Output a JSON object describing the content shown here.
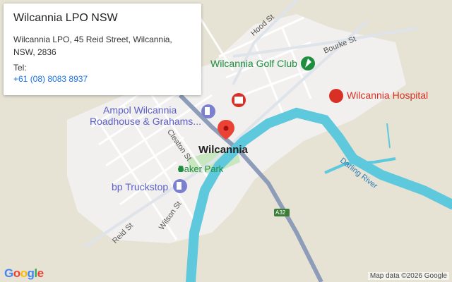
{
  "card": {
    "title": "Wilcannia LPO NSW",
    "address": "Wilcannia LPO, 45 Reid Street, Wilcannia, NSW, 2836",
    "tel_label": "Tel:",
    "phone": "+61 (08) 8083 8937"
  },
  "map": {
    "town_label": "Wilcannia",
    "pois": {
      "golf_club": "Wilcannia Golf Club",
      "hospital": "Wilcannia Hospital",
      "ampol_line1": "Ampol Wilcannia",
      "ampol_line2": "Roadhouse & Grahams...",
      "bp": "bp Truckstop",
      "park": "Baker Park"
    },
    "streets": {
      "hood": "Hood St",
      "bourke": "Bourke St",
      "cleaton": "Cleaton St",
      "wilson": "Wilson St",
      "reid": "Reid St"
    },
    "river": "Darling River",
    "highway_shield": "A32",
    "attribution": "Map data ©2026 Google",
    "logo": [
      "G",
      "o",
      "o",
      "g",
      "l",
      "e"
    ],
    "colors": {
      "water": "#5ec8dc",
      "land": "#e8e4d8",
      "urban": "#f1f1f1",
      "park": "#c8e6c0",
      "highway": "#8d9cb8",
      "green_poi": "#1e8e3e",
      "red_poi": "#d93025",
      "fuel_poi": "#7b7fcf",
      "pin": "#ea4335",
      "link": "#1a73e8"
    }
  }
}
